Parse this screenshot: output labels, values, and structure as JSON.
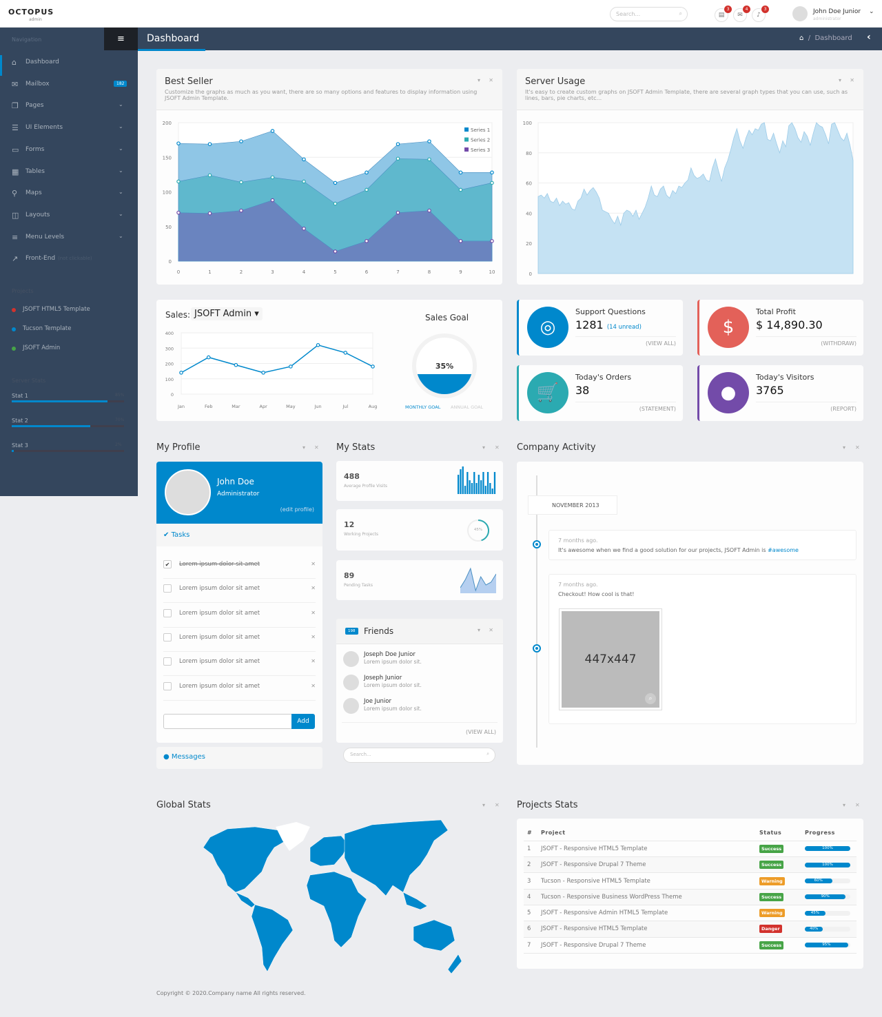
{
  "header": {
    "logo": "OCTOPUS",
    "logo_sub": "admin",
    "search_placeholder": "Search...",
    "notifications": [
      {
        "icon": "tasks-icon",
        "count": "3"
      },
      {
        "icon": "envelope-icon",
        "count": "4"
      },
      {
        "icon": "bell-icon",
        "count": "3"
      }
    ],
    "user_name": "John Doe Junior",
    "user_role": "administrator"
  },
  "page": {
    "title": "Dashboard",
    "breadcrumb": "Dashboard"
  },
  "sidebar": {
    "nav_heading": "Navigation",
    "items": [
      {
        "label": "Dashboard",
        "icon": "home-icon"
      },
      {
        "label": "Mailbox",
        "icon": "envelope-icon",
        "badge": "182"
      },
      {
        "label": "Pages",
        "icon": "copy-icon"
      },
      {
        "label": "UI Elements",
        "icon": "tasks-icon"
      },
      {
        "label": "Forms",
        "icon": "list-alt-icon"
      },
      {
        "label": "Tables",
        "icon": "table-icon"
      },
      {
        "label": "Maps",
        "icon": "map-marker-icon"
      },
      {
        "label": "Layouts",
        "icon": "columns-icon"
      },
      {
        "label": "Menu Levels",
        "icon": "align-left-icon"
      },
      {
        "label": "Front-End",
        "icon": "external-link-icon",
        "note": "(not clickable)"
      }
    ],
    "projects_heading": "Projects",
    "projects": [
      {
        "label": "JSOFT HTML5 Template",
        "color": "#d2322d"
      },
      {
        "label": "Tucson Template",
        "color": "#0088cc"
      },
      {
        "label": "JSOFT Admin",
        "color": "#47a447"
      }
    ],
    "stats_heading": "Server Stats",
    "stats": [
      {
        "label": "Stat 1",
        "percent": 85
      },
      {
        "label": "Stat 2",
        "percent": 70
      },
      {
        "label": "Stat 3",
        "percent": 2
      }
    ]
  },
  "best_seller": {
    "title": "Best Seller",
    "desc": "Customize the graphs as much as you want, there are so many options and features to display information using JSOFT Admin Template."
  },
  "server_usage": {
    "title": "Server Usage",
    "desc": "It's easy to create custom graphs on JSOFT Admin Template, there are several graph types that you can use, such as lines, bars, pie charts, etc..."
  },
  "sales": {
    "label": "Sales:",
    "selected": "JSOFT Admin",
    "goal_title": "Sales Goal",
    "goal_percent": "35%",
    "goal_value": 35,
    "tab_monthly": "MONTHLY GOAL",
    "tab_annual": "ANNUAL GOAL"
  },
  "cards": [
    {
      "title": "Support Questions",
      "value": "1281",
      "extra": "(14 unread)",
      "link": "(VIEW ALL)",
      "icon": "life-ring-icon",
      "color": "#0088cc"
    },
    {
      "title": "Total Profit",
      "value": "$ 14,890.30",
      "link": "(WITHDRAW)",
      "icon": "dollar-icon",
      "color": "#e36159"
    },
    {
      "title": "Today's Orders",
      "value": "38",
      "link": "(STATEMENT)",
      "icon": "shopping-cart-icon",
      "color": "#2baab1"
    },
    {
      "title": "Today's Visitors",
      "value": "3765",
      "link": "(REPORT)",
      "icon": "user-icon",
      "color": "#734ba9"
    }
  ],
  "profile": {
    "section_title": "My Profile",
    "name": "John Doe",
    "role": "Administrator",
    "edit": "(edit profile)",
    "tasks_title": "Tasks",
    "tasks": [
      {
        "text": "Lorem ipsum dolor sit amet",
        "done": true
      },
      {
        "text": "Lorem ipsum dolor sit amet",
        "done": false
      },
      {
        "text": "Lorem ipsum dolor sit amet",
        "done": false
      },
      {
        "text": "Lorem ipsum dolor sit amet",
        "done": false
      },
      {
        "text": "Lorem ipsum dolor sit amet",
        "done": false
      },
      {
        "text": "Lorem ipsum dolor sit amet",
        "done": false
      }
    ],
    "add_label": "Add",
    "messages_label": "Messages"
  },
  "my_stats": {
    "section_title": "My Stats",
    "items": [
      {
        "value": "488",
        "label": "Average Profile Visits",
        "bars": [
          7,
          9,
          10,
          3,
          8,
          5,
          4,
          8,
          4,
          7,
          5,
          8,
          3,
          8,
          4,
          2,
          8
        ]
      },
      {
        "value": "12",
        "label": "Working Projects",
        "percent": "45%",
        "percent_value": 45
      },
      {
        "value": "89",
        "label": "Pending Tasks",
        "spark": [
          2,
          5,
          9,
          1,
          6,
          3,
          4,
          7
        ]
      }
    ]
  },
  "friends": {
    "count": "198",
    "title": "Friends",
    "list": [
      {
        "name": "Joseph Doe Junior",
        "status": "Lorem ipsum dolor sit."
      },
      {
        "name": "Joseph Junior",
        "status": "Lorem ipsum dolor sit."
      },
      {
        "name": "Joe Junior",
        "status": "Lorem ipsum dolor sit."
      }
    ],
    "view_all": "(VIEW ALL)",
    "search_placeholder": "Search..."
  },
  "activity": {
    "section_title": "Company Activity",
    "month": "NOVEMBER 2013",
    "posts": [
      {
        "time": "7 months ago.",
        "text": "It's awesome when we find a good solution for our projects, JSOFT Admin is ",
        "tag": "#awesome"
      },
      {
        "time": "7 months ago.",
        "text": "Checkout! How cool is that!",
        "image_label": "447x447"
      }
    ]
  },
  "global_stats": {
    "section_title": "Global Stats",
    "highlight_color": "#0088cc"
  },
  "projects_stats": {
    "section_title": "Projects Stats",
    "columns": [
      "#",
      "Project",
      "Status",
      "Progress"
    ],
    "rows": [
      {
        "n": "1",
        "project": "JSOFT - Responsive HTML5 Template",
        "status": "Success",
        "progress": 100
      },
      {
        "n": "2",
        "project": "JSOFT - Responsive Drupal 7 Theme",
        "status": "Success",
        "progress": 100
      },
      {
        "n": "3",
        "project": "Tucson - Responsive HTML5 Template",
        "status": "Warning",
        "progress": 60
      },
      {
        "n": "4",
        "project": "Tucson - Responsive Business WordPress Theme",
        "status": "Success",
        "progress": 90
      },
      {
        "n": "5",
        "project": "JSOFT - Responsive Admin HTML5 Template",
        "status": "Warning",
        "progress": 45
      },
      {
        "n": "6",
        "project": "JSOFT - Responsive HTML5 Template",
        "status": "Danger",
        "progress": 40
      },
      {
        "n": "7",
        "project": "JSOFT - Responsive Drupal 7 Theme",
        "status": "Success",
        "progress": 95
      }
    ]
  },
  "status_colors": {
    "Success": "#47a447",
    "Warning": "#ed9c28",
    "Danger": "#d2322d"
  },
  "footer": "Copyright © 2020.Company name All rights reserved.",
  "chart_data": [
    {
      "type": "area",
      "stacked": true,
      "x": [
        0,
        1,
        2,
        3,
        4,
        5,
        6,
        7,
        8,
        9,
        10
      ],
      "ylim": [
        0,
        200
      ],
      "yticks": [
        0,
        50,
        100,
        150,
        200
      ],
      "legend": "top-right",
      "series": [
        {
          "name": "Series 1",
          "color": "#0088cc",
          "values": [
            55,
            45,
            59,
            67,
            32,
            30,
            25,
            21,
            26,
            25,
            15
          ]
        },
        {
          "name": "Series 2",
          "color": "#2baab1",
          "values": [
            45,
            55,
            41,
            33,
            68,
            69,
            74,
            78,
            74,
            74,
            84
          ]
        },
        {
          "name": "Series 3",
          "color": "#734ba9",
          "values": [
            70,
            69,
            73,
            88,
            47,
            14,
            29,
            70,
            73,
            29,
            29
          ]
        }
      ]
    },
    {
      "type": "area",
      "ylim": [
        0,
        100
      ],
      "yticks": [
        0,
        20,
        40,
        60,
        80,
        100
      ],
      "color": "#0088cc",
      "values": [
        51,
        52,
        50,
        53,
        48,
        47,
        50,
        45,
        48,
        46,
        47,
        43,
        42,
        48,
        50,
        56,
        52,
        55,
        57,
        54,
        50,
        42,
        41,
        40,
        36,
        33,
        38,
        32,
        40,
        42,
        41,
        38,
        42,
        36,
        40,
        44,
        50,
        58,
        52,
        51,
        56,
        58,
        52,
        50,
        55,
        53,
        58,
        57,
        60,
        62,
        70,
        65,
        63,
        64,
        66,
        62,
        61,
        70,
        76,
        68,
        61,
        70,
        75,
        82,
        90,
        96,
        88,
        83,
        90,
        95,
        92,
        96,
        95,
        99,
        100,
        89,
        88,
        93,
        86,
        80,
        88,
        84,
        98,
        100,
        96,
        90,
        87,
        94,
        91,
        85,
        93,
        100,
        98,
        97,
        92,
        86,
        99,
        100,
        95,
        90,
        88,
        93,
        85,
        75
      ]
    },
    {
      "type": "line",
      "categories": [
        "Jan",
        "Feb",
        "Mar",
        "Apr",
        "May",
        "Jun",
        "Jul",
        "Aug"
      ],
      "values": [
        140,
        240,
        190,
        140,
        180,
        320,
        270,
        180
      ],
      "ylim": [
        0,
        400
      ],
      "yticks": [
        0,
        100,
        200,
        300,
        400
      ],
      "color": "#0088cc"
    }
  ]
}
